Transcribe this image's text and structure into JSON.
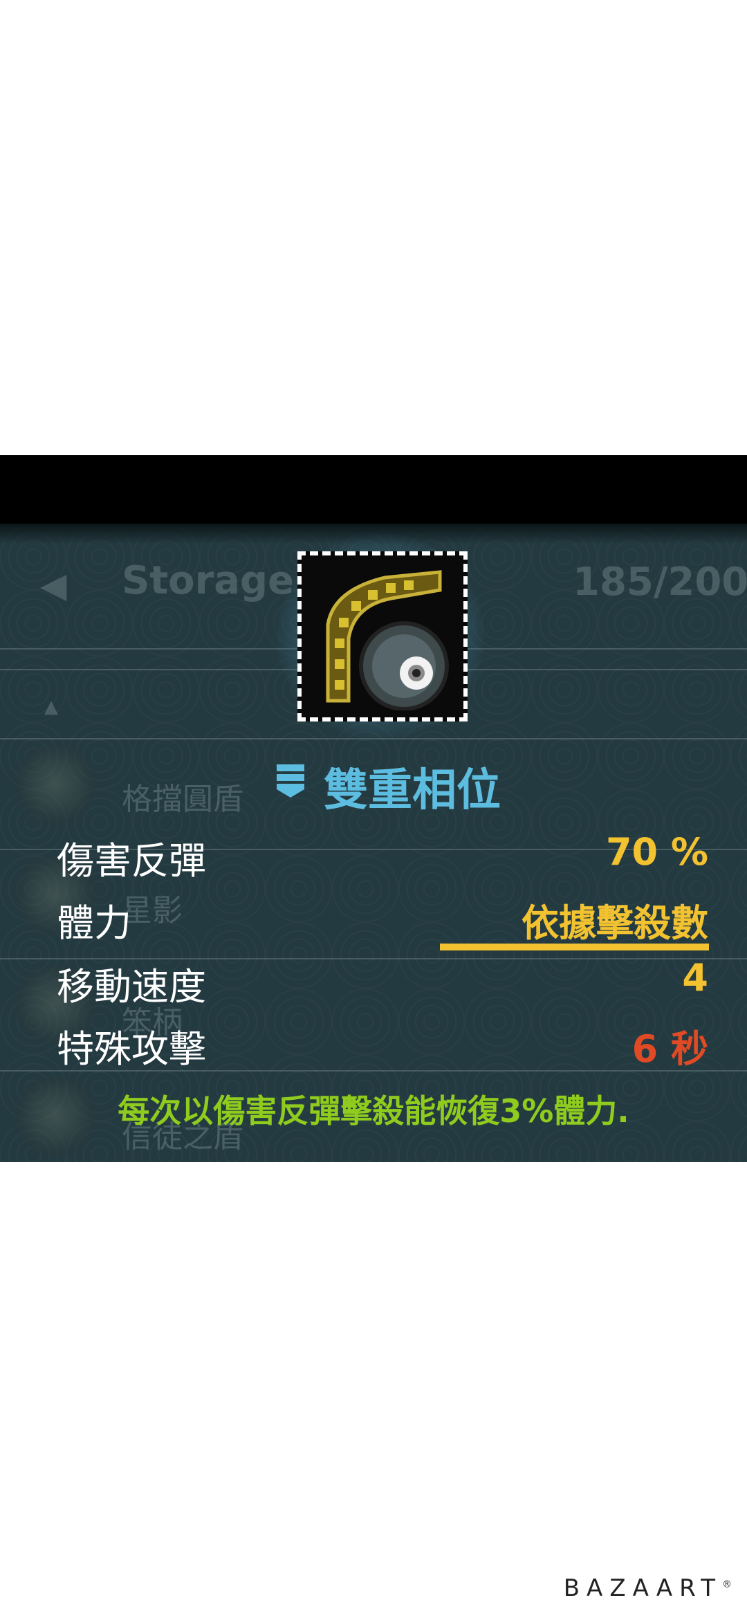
{
  "header": {
    "back_arrow": "◀",
    "title": "Storage",
    "count": "185/200"
  },
  "list": {
    "up_arrow": "▲",
    "items": [
      "格擋圓盾",
      "星影",
      "笨柄",
      "信徒之盾"
    ]
  },
  "item": {
    "icon": "double-phase-shield-icon",
    "name": "雙重相位",
    "stats": [
      {
        "label": "傷害反彈",
        "value": "70 %"
      },
      {
        "label": "體力",
        "value": "依據擊殺數"
      },
      {
        "label": "移動速度",
        "value": "4"
      },
      {
        "label": "特殊攻擊",
        "value": "6 秒"
      }
    ],
    "description": "每次以傷害反彈擊殺能恢復3%體力."
  },
  "watermark": {
    "brand": "BAZAART",
    "mark": "®"
  },
  "colors": {
    "title": "#5dbde0",
    "value_yellow": "#f2c230",
    "value_red": "#e04a24",
    "description": "#8fcc1e",
    "panel_bg": "#243a41"
  }
}
